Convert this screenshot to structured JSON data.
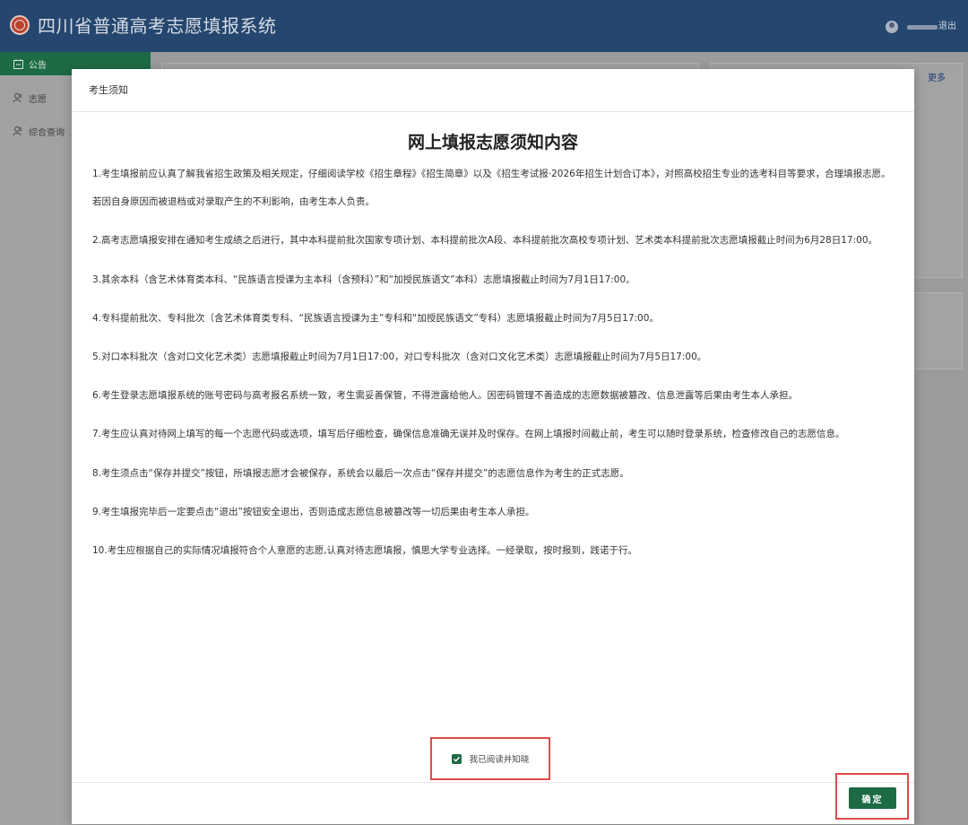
{
  "header": {
    "title": "四川省普通高考志愿填报系统",
    "logout_label": "退出",
    "accent": "#25466e"
  },
  "sidebar": {
    "items": [
      {
        "label": "公告",
        "icon": "notice-icon",
        "active": true
      },
      {
        "label": "志愿",
        "icon": "user-icon",
        "active": false
      },
      {
        "label": "综合查询",
        "icon": "user-icon",
        "active": false
      }
    ]
  },
  "background": {
    "more_label": "更多"
  },
  "modal": {
    "title": "考生须知",
    "heading": "网上填报志愿须知内容",
    "items": [
      "1.考生填报前应认真了解我省招生政策及相关规定，仔细阅读学校《招生章程》《招生简章》以及《招生考试报·2026年招生计划合订本》，对照高校招生专业的选考科目等要求，合理填报志愿。若因自身原因而被退档或对录取产生的不利影响，由考生本人负责。",
      "2.高考志愿填报安排在通知考生成绩之后进行，其中本科提前批次国家专项计划、本科提前批次A段、本科提前批次高校专项计划、艺术类本科提前批次志愿填报截止时间为6月28日17:00。",
      "3.其余本科（含艺术体育类本科、“民族语言授课为主本科（含预科）”和“加授民族语文”本科）志愿填报截止时间为7月1日17:00。",
      "4.专科提前批次、专科批次（含艺术体育类专科、“民族语言授课为主”专科和“加授民族语文”专科）志愿填报截止时间为7月5日17:00。",
      "5.对口本科批次（含对口文化艺术类）志愿填报截止时间为7月1日17:00，对口专科批次（含对口文化艺术类）志愿填报截止时间为7月5日17:00。",
      "6.考生登录志愿填报系统的账号密码与高考报名系统一致，考生需妥善保管，不得泄露给他人。因密码管理不善造成的志愿数据被篡改、信息泄露等后果由考生本人承担。",
      "7.考生应认真对待网上填写的每一个志愿代码或选项，填写后仔细检查，确保信息准确无误并及时保存。在网上填报时间截止前，考生可以随时登录系统，检查修改自己的志愿信息。",
      "8.考生须点击“保存并提交”按钮，所填报志愿才会被保存，系统会以最后一次点击“保存并提交”的志愿信息作为考生的正式志愿。",
      "9.考生填报完毕后一定要点击“退出”按钮安全退出，否则造成志愿信息被篡改等一切后果由考生本人承担。",
      "10.考生应根据自己的实际情况填报符合个人意愿的志愿,认真对待志愿填报，慎思大学专业选择。一经录取，按时报到，践诺于行。"
    ],
    "agree_label": "我已阅读并知晓",
    "agree_checked": true,
    "confirm_label": "确定",
    "primary_color": "#1d6b45",
    "highlight_color": "#e04a4a"
  }
}
